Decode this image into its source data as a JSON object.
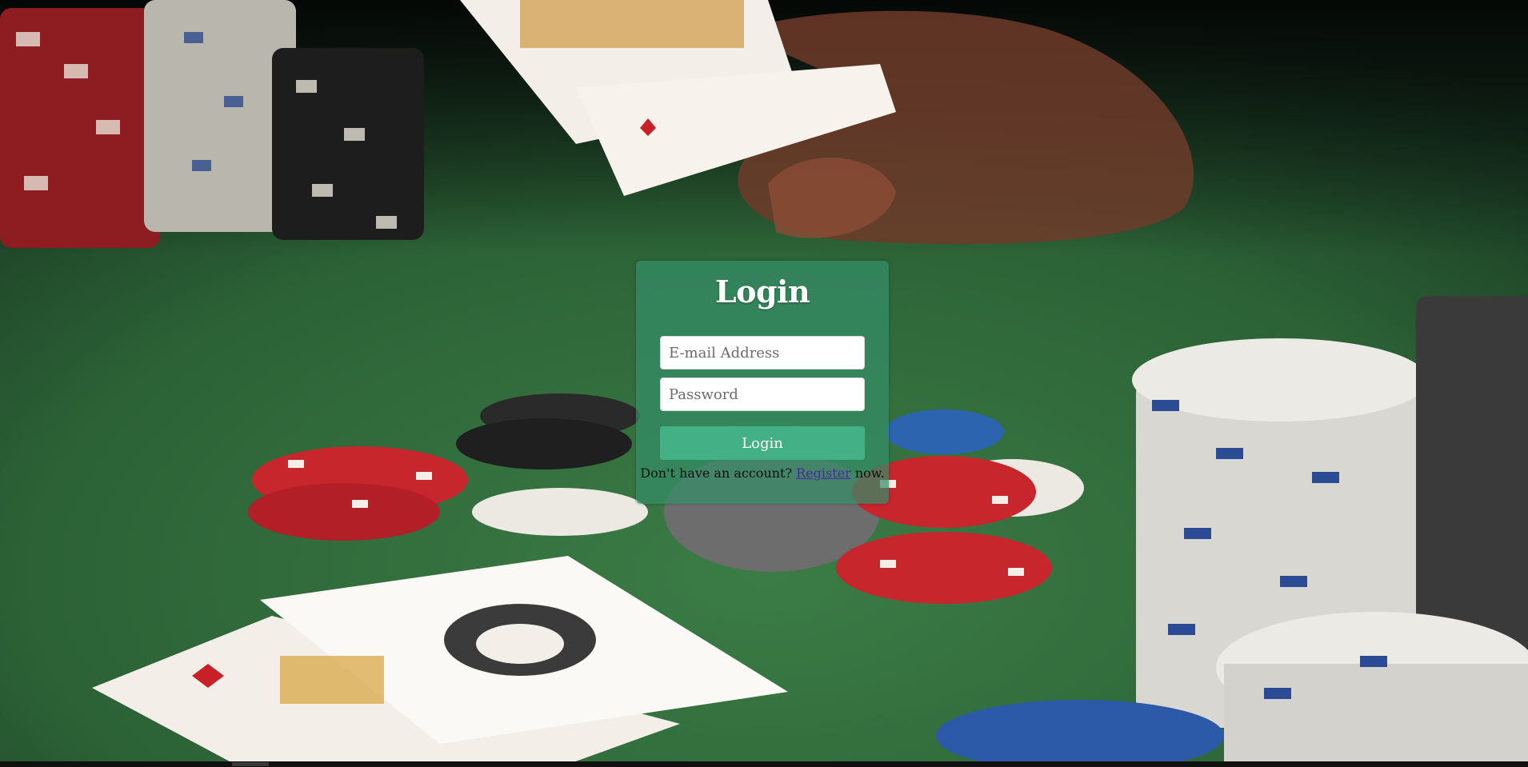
{
  "background": {
    "description_icon": "poker-table-image",
    "felt_color": "#2f6a3c"
  },
  "login": {
    "title": "Login",
    "email_placeholder": "E-mail Address",
    "email_value": "",
    "password_placeholder": "Password",
    "password_value": "",
    "button_label": "Login",
    "register_prefix": "Don't have an account? ",
    "register_link": "Register",
    "register_suffix": " now."
  },
  "colors": {
    "panel": "#348e68",
    "button": "#43b185",
    "link": "#4a2a9a"
  }
}
